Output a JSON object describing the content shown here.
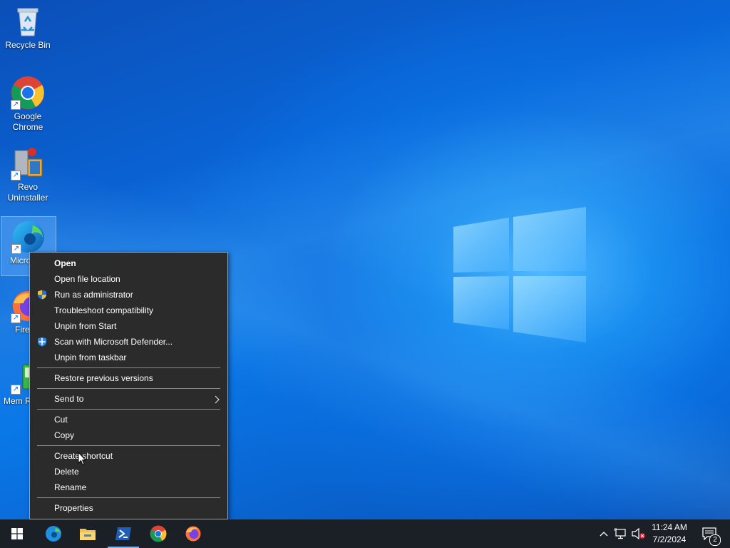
{
  "desktop": {
    "icons": [
      {
        "label": "Recycle Bin"
      },
      {
        "label": "Google Chrome"
      },
      {
        "label": "Revo Uninstaller"
      },
      {
        "label": "Micro Edg"
      },
      {
        "label": "Fire"
      },
      {
        "label": "Mem R"
      }
    ]
  },
  "context_menu": {
    "items": [
      {
        "label": "Open",
        "icon": ""
      },
      {
        "label": "Open file location",
        "icon": ""
      },
      {
        "label": "Run as administrator",
        "icon": "uac-shield-icon"
      },
      {
        "label": "Troubleshoot compatibility",
        "icon": ""
      },
      {
        "label": "Unpin from Start",
        "icon": ""
      },
      {
        "label": "Scan with Microsoft Defender...",
        "icon": "defender-icon"
      },
      {
        "label": "Unpin from taskbar",
        "icon": ""
      },
      {
        "label": "Restore previous versions",
        "icon": ""
      },
      {
        "label": "Send to",
        "icon": "chevron-right-icon"
      },
      {
        "label": "Cut",
        "icon": ""
      },
      {
        "label": "Copy",
        "icon": ""
      },
      {
        "label": "Create shortcut",
        "icon": ""
      },
      {
        "label": "Delete",
        "icon": ""
      },
      {
        "label": "Rename",
        "icon": ""
      },
      {
        "label": "Properties",
        "icon": ""
      }
    ]
  },
  "taskbar": {
    "apps": [
      "start-icon",
      "edge-icon",
      "file-explorer-icon",
      "powershell-icon",
      "chrome-icon",
      "firefox-icon"
    ],
    "clock": {
      "time": "11:24 AM",
      "date": "7/2/2024"
    },
    "notification_count": "2"
  },
  "colors": {
    "menu_bg": "#2b2b2b",
    "taskbar_bg": "#1b1f26",
    "desktop_blue": "#0a6fe0"
  }
}
